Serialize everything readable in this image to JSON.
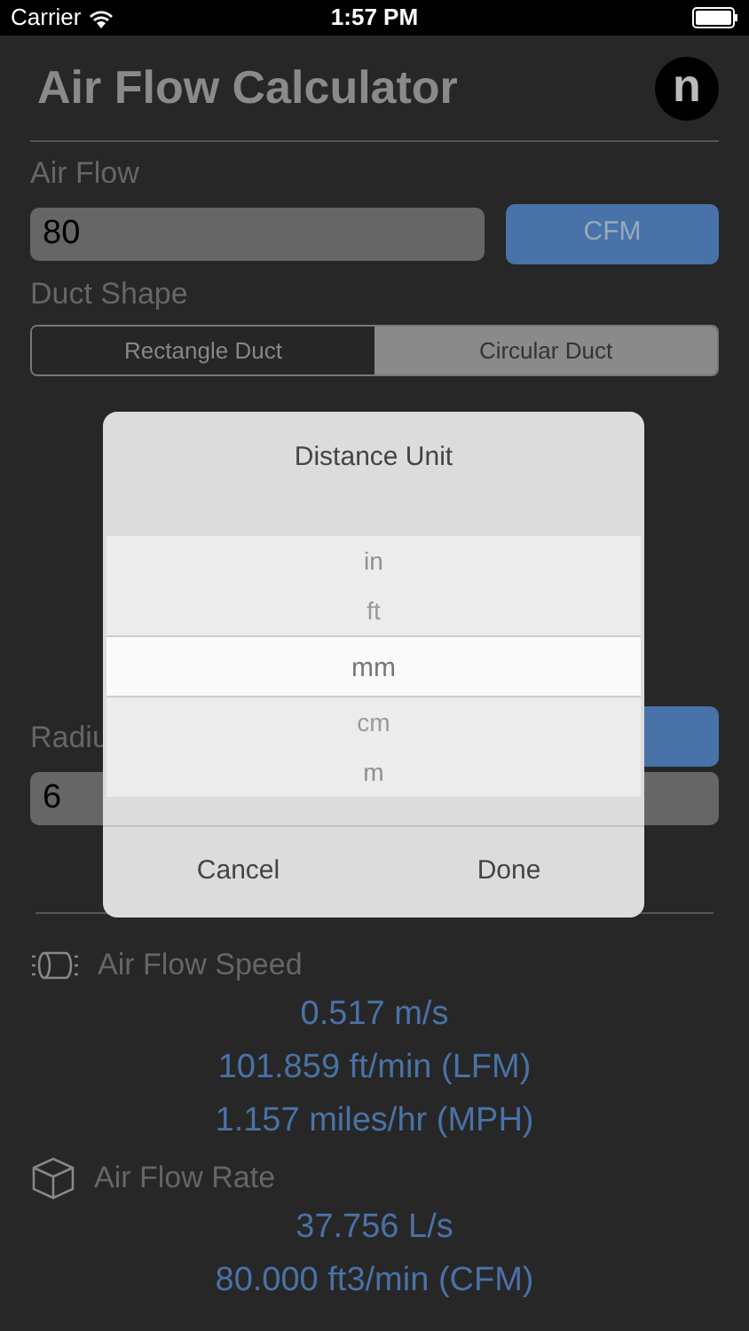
{
  "status_bar": {
    "carrier": "Carrier",
    "time": "1:57 PM"
  },
  "title": "Air Flow Calculator",
  "logo": "n",
  "air_flow": {
    "label": "Air Flow",
    "value": "80",
    "unit": "CFM"
  },
  "duct_shape": {
    "label": "Duct Shape",
    "options": [
      {
        "label": "Rectangle Duct",
        "selected": false
      },
      {
        "label": "Circular Duct",
        "selected": true
      }
    ]
  },
  "radius": {
    "label": "Radiu",
    "value": "6"
  },
  "results": [
    {
      "kind": "speed",
      "label": "Air Flow Speed",
      "values": [
        "0.517 m/s",
        "101.859 ft/min (LFM)",
        "1.157 miles/hr (MPH)"
      ]
    },
    {
      "kind": "rate",
      "label": "Air Flow Rate",
      "values": [
        "37.756 L/s",
        "80.000 ft3/min (CFM)"
      ]
    }
  ],
  "dialog": {
    "title": "Distance Unit",
    "options": [
      {
        "label": "in",
        "selected": false
      },
      {
        "label": "ft",
        "selected": false
      },
      {
        "label": "mm",
        "selected": true
      },
      {
        "label": "cm",
        "selected": false
      },
      {
        "label": "m",
        "selected": false
      }
    ],
    "buttons": [
      "Cancel",
      "Done"
    ]
  }
}
